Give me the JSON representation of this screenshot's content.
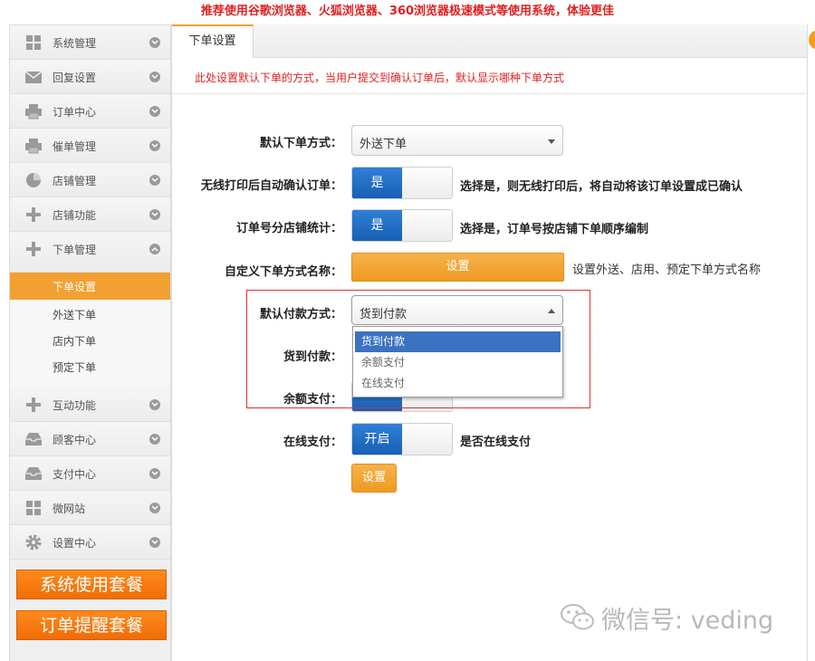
{
  "top_notice": "推荐使用谷歌浏览器、火狐浏览器、360浏览器极速模式等使用系统，体验更佳",
  "sidebar": {
    "items": [
      {
        "label": "系统管理",
        "icon": "grid-icon"
      },
      {
        "label": "回复设置",
        "icon": "envelope-icon"
      },
      {
        "label": "订单中心",
        "icon": "printer-icon"
      },
      {
        "label": "催单管理",
        "icon": "printer-icon"
      },
      {
        "label": "店铺管理",
        "icon": "pie-chart-icon"
      },
      {
        "label": "店铺功能",
        "icon": "plus-icon"
      },
      {
        "label": "下单管理",
        "icon": "plus-icon"
      },
      {
        "label": "互动功能",
        "icon": "plus-icon"
      },
      {
        "label": "顾客中心",
        "icon": "inbox-icon"
      },
      {
        "label": "支付中心",
        "icon": "inbox-icon"
      },
      {
        "label": "微网站",
        "icon": "grid-icon"
      },
      {
        "label": "设置中心",
        "icon": "gear-icon"
      }
    ],
    "sub_items": [
      "下单设置",
      "外送下单",
      "店内下单",
      "预定下单"
    ],
    "buttons": [
      "系统使用套餐",
      "订单提醒套餐"
    ]
  },
  "tab": "下单设置",
  "hint": "此处设置默认下单的方式，当用户提交到确认订单后，默认显示哪种下单方式",
  "form": {
    "default_order_label": "默认下单方式：",
    "default_order_value": "外送下单",
    "auto_confirm_label": "无线打印后自动确认订单：",
    "auto_confirm_toggle": "是",
    "auto_confirm_desc": "选择是，则无线打印后，将自动将该订单设置成已确认",
    "order_no_label": "订单号分店铺统计：",
    "order_no_toggle": "是",
    "order_no_desc": "选择是，订单号按店铺下单顺序编制",
    "custom_name_label": "自定义下单方式名称：",
    "custom_name_button": "设置",
    "custom_name_desc": "设置外送、店用、预定下单方式名称",
    "default_pay_label": "默认付款方式：",
    "default_pay_value": "货到付款",
    "pay_options": [
      "货到付款",
      "余额支付",
      "在线支付"
    ],
    "cod_label": "货到付款：",
    "balance_label": "余额支付：",
    "online_label": "在线支付：",
    "online_toggle": "开启",
    "online_desc": "是否在线支付",
    "save_button": "设置"
  },
  "watermark": "微信号: veding",
  "colors": {
    "accent_orange": "#f1a031",
    "toggle_blue": "#1f6dc7",
    "notice_red": "#e02020",
    "button_orange": "#f06d06"
  }
}
